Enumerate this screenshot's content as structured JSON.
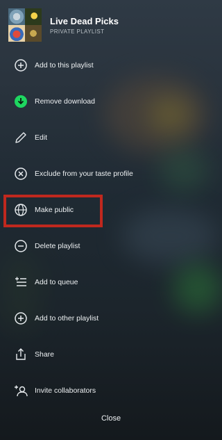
{
  "playlist": {
    "title": "Live Dead Picks",
    "subtitle": "PRIVATE PLAYLIST"
  },
  "menu": [
    {
      "label": "Add to this playlist",
      "icon": "plus-circle-icon"
    },
    {
      "label": "Remove download",
      "icon": "download-check-icon"
    },
    {
      "label": "Edit",
      "icon": "pencil-icon"
    },
    {
      "label": "Exclude from your taste profile",
      "icon": "x-circle-icon"
    },
    {
      "label": "Make public",
      "icon": "globe-icon"
    },
    {
      "label": "Delete playlist",
      "icon": "minus-circle-icon"
    },
    {
      "label": "Add to queue",
      "icon": "add-queue-icon"
    },
    {
      "label": "Add to other playlist",
      "icon": "plus-circle-icon"
    },
    {
      "label": "Share",
      "icon": "share-icon"
    },
    {
      "label": "Invite collaborators",
      "icon": "add-person-icon"
    }
  ],
  "close_label": "Close",
  "colors": {
    "download_green": "#1ed760",
    "highlight_red": "#c0281e"
  }
}
